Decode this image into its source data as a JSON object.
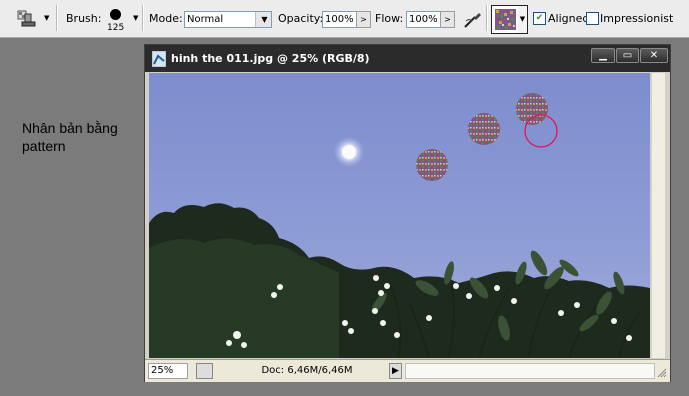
{
  "options_bar": {
    "tool_icon": "pattern-stamp-icon",
    "brush": {
      "label": "Brush:",
      "size": "125"
    },
    "mode": {
      "label": "Mode:",
      "value": "Normal"
    },
    "opacity": {
      "label": "Opacity:",
      "value": "100%"
    },
    "flow": {
      "label": "Flow:",
      "value": "100%"
    },
    "airbrush_icon": "airbrush-icon",
    "aligned": {
      "label": "Aligned",
      "checked": true
    },
    "impressionist": {
      "label": "Impressionist",
      "checked": false
    }
  },
  "caption": {
    "line1": "Nhân bản bằng",
    "line2": "pattern"
  },
  "document": {
    "title": "hinh the 011.jpg @ 25% (RGB/8)",
    "zoom": "25%",
    "doc_info": "Doc: 6,46M/6,46M"
  },
  "colors": {
    "sky_top": "#7f8fcf",
    "sky_bottom": "#99a7d8",
    "brush_cursor": "#e0145a",
    "pattern_accent": "#b03a6a"
  }
}
